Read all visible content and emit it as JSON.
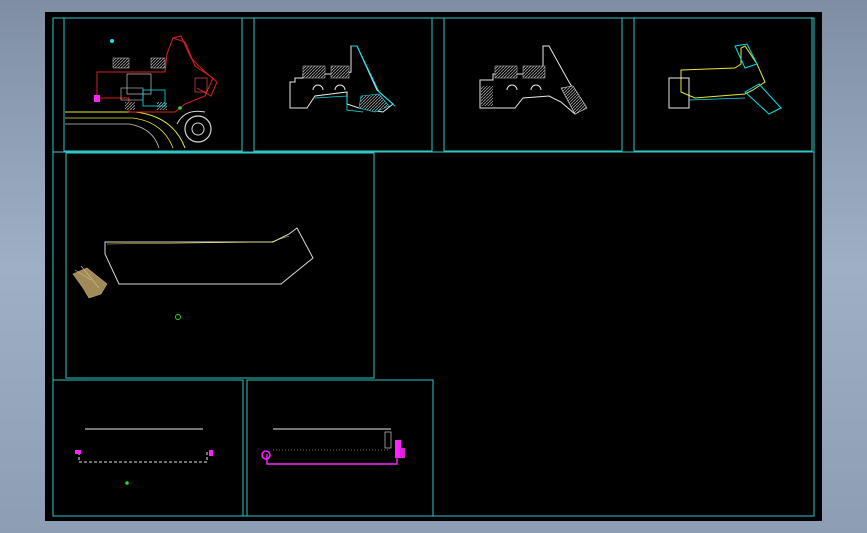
{
  "viewport": {
    "name": "model-space",
    "background_color": "#000000",
    "frame_color": "#2fc7c7"
  },
  "colors": {
    "cyan": "#00e5ee",
    "white": "#e8e8e8",
    "red": "#e0201a",
    "yellow": "#e8e832",
    "magenta": "#ff22ff",
    "green": "#22dd22",
    "tan": "#a08a55",
    "hatch": "#9a9a9a"
  },
  "sheets": [
    {
      "id": "plan-1",
      "content": "ground-floor-plan-red"
    },
    {
      "id": "plan-2",
      "content": "floor-plan-white"
    },
    {
      "id": "plan-3",
      "content": "floor-plan-white-hatched"
    },
    {
      "id": "plan-4",
      "content": "roof-plan-outline"
    },
    {
      "id": "plan-5",
      "content": "site-outline-large"
    },
    {
      "id": "elev-1",
      "content": "elevation-dashed"
    },
    {
      "id": "elev-2",
      "content": "elevation-magenta"
    }
  ]
}
